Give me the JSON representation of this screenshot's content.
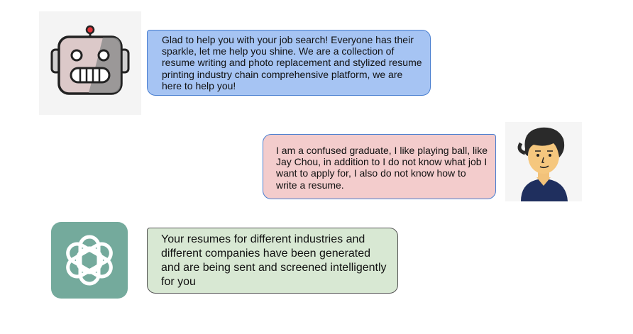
{
  "conversation": {
    "messages": [
      {
        "sender": "bot",
        "avatar_icon": "robot-icon",
        "bubble_color": "#a6c4f3",
        "text": "Glad to help you with your job search! Everyone has their sparkle, let me help you shine. We are a collection of resume writing and photo replacement and stylized resume printing industry chain comprehensive platform, we are here to help you!"
      },
      {
        "sender": "user",
        "avatar_icon": "user-avatar-icon",
        "bubble_color": "#f3cccc",
        "text": "I am a confused graduate, I like playing ball, like Jay Chou, in addition to I do not know what job I want to apply for, I also do not know how to write a resume."
      },
      {
        "sender": "assistant",
        "avatar_icon": "openai-logo-icon",
        "bubble_color": "#d8e8d3",
        "text": "Your resumes for different industries and different companies have been generated and are being sent and screened intelligently for you"
      }
    ]
  }
}
